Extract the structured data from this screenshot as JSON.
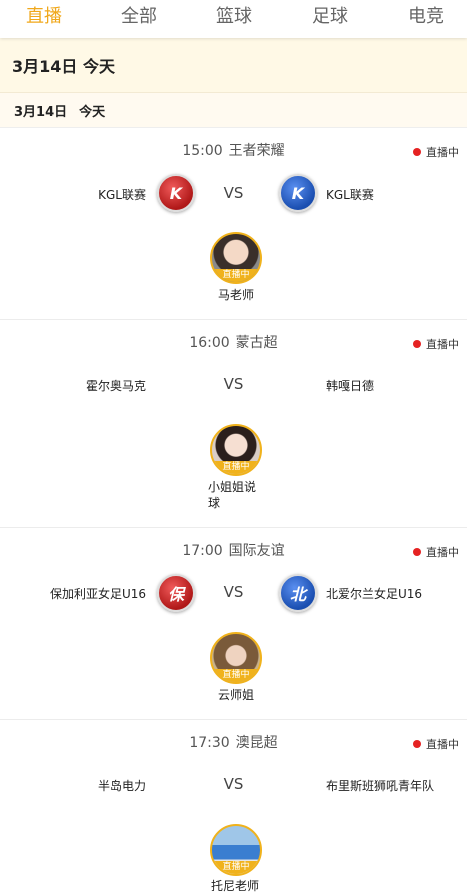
{
  "tabs": [
    "直播",
    "全部",
    "篮球",
    "足球",
    "电竞"
  ],
  "date_banner": "3月14日 今天",
  "date_sub": {
    "date": "3月14日",
    "day": "今天"
  },
  "matches": [
    {
      "time": "15:00",
      "league": "王者荣耀",
      "status": "直播中",
      "home": "KGL联赛",
      "away": "KGL联赛",
      "home_logo": "K",
      "away_logo": "K",
      "vs": "VS",
      "anchor_tag": "直播中",
      "anchor": "马老师"
    },
    {
      "time": "16:00",
      "league": "蒙古超",
      "status": "直播中",
      "home": "霍尔奥马克",
      "away": "韩嘎日德",
      "vs": "VS",
      "anchor_tag": "直播中",
      "anchor_line1": "小姐姐说",
      "anchor_line2": "球"
    },
    {
      "time": "17:00",
      "league": "国际友谊",
      "status": "直播中",
      "home": "保加利亚女足U16",
      "away": "北爱尔兰女足U16",
      "home_logo": "保",
      "away_logo": "北",
      "vs": "VS",
      "anchor_tag": "直播中",
      "anchor": "云师姐"
    },
    {
      "time": "17:30",
      "league": "澳昆超",
      "status": "直播中",
      "home": "半岛电力",
      "away": "布里斯班狮吼青年队",
      "vs": "VS",
      "anchor_tag": "直播中",
      "anchor": "托尼老师"
    }
  ]
}
